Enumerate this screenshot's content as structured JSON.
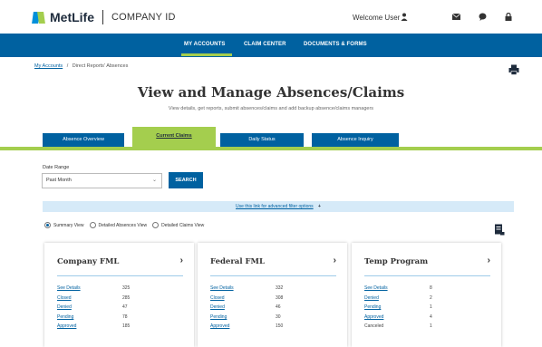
{
  "header": {
    "brand": "MetLife",
    "app_name": "COMPANY ID",
    "welcome": "Welcome User",
    "icons": [
      "user-icon",
      "mail-icon",
      "chat-icon",
      "lock-icon"
    ]
  },
  "nav": {
    "items": [
      "MY ACCOUNTS",
      "CLAIM CENTER",
      "DOCUMENTS & FORMS"
    ],
    "active": "MY ACCOUNTS"
  },
  "breadcrumb": {
    "link": "My Accounts",
    "separator": "/",
    "rest": "Direct Reports' Absences"
  },
  "page": {
    "title": "View and Manage Absences/Claims",
    "subtitle": "View details, get reports, submit absences/claims and add backup absence/claims managers"
  },
  "tabs": [
    "Absence Overview",
    "Current Claims",
    "Daily Status",
    "Absence Inquiry"
  ],
  "active_tab": "Current Claims",
  "filter": {
    "date_label": "Date Range",
    "date_value": "Past Month",
    "search_label": "SEARCH",
    "advanced_link": "Use this link for advanced filter options",
    "advanced_plus": "+"
  },
  "views": {
    "options": [
      "Summary View",
      "Detailed Absences View",
      "Detailed Claims View"
    ],
    "selected": "Summary View"
  },
  "cards": [
    {
      "title": "Company FML",
      "rows": [
        {
          "label": "See Details",
          "value": "325"
        },
        {
          "label": "Closed",
          "value": "285"
        },
        {
          "label": "Denied",
          "value": "47"
        },
        {
          "label": "Pending",
          "value": "78"
        },
        {
          "label": "Approved",
          "value": "185"
        }
      ]
    },
    {
      "title": "Federal FML",
      "rows": [
        {
          "label": "See Details",
          "value": "332"
        },
        {
          "label": "Closed",
          "value": "308"
        },
        {
          "label": "Denied",
          "value": "46"
        },
        {
          "label": "Pending",
          "value": "30"
        },
        {
          "label": "Approved",
          "value": "150"
        }
      ]
    },
    {
      "title": "Temp Program",
      "rows": [
        {
          "label": "See Details",
          "value": "8"
        },
        {
          "label": "Denied",
          "value": "2"
        },
        {
          "label": "Pending",
          "value": "1"
        },
        {
          "label": "Approved",
          "value": "4"
        },
        {
          "label": "Canceled",
          "value": "1"
        }
      ]
    }
  ],
  "colors": {
    "brand_blue": "#0061a0",
    "brand_green": "#a4ce4e",
    "light_blue": "#d6eaf8"
  }
}
